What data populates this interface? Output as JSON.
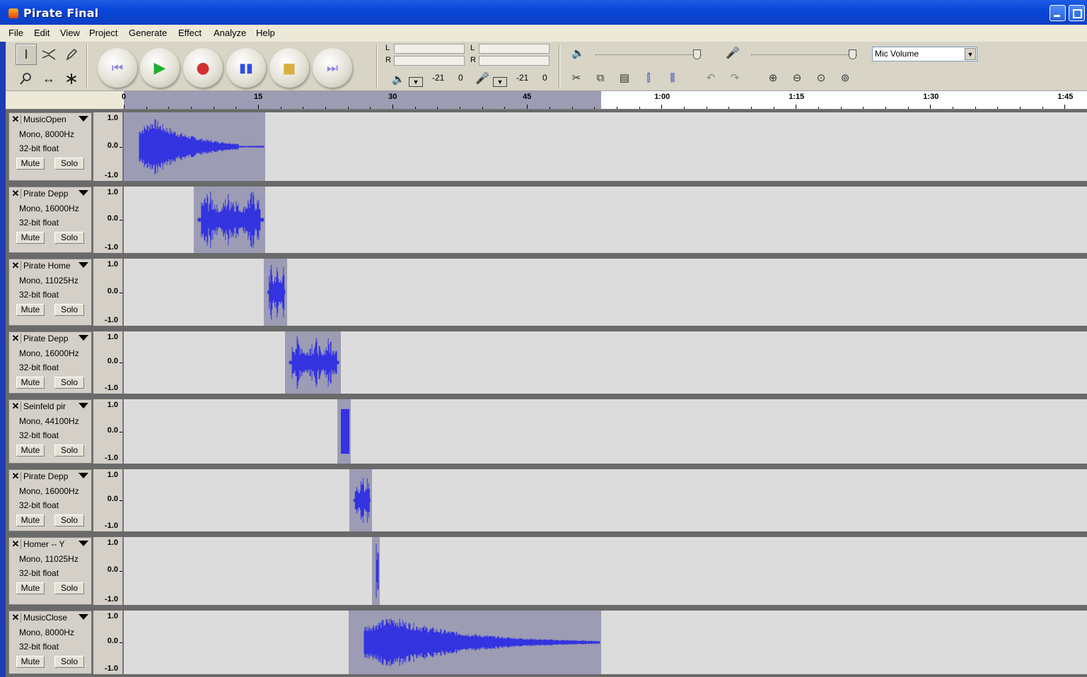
{
  "window": {
    "title": "Pirate Final"
  },
  "menu": [
    "File",
    "Edit",
    "View",
    "Project",
    "Generate",
    "Effect",
    "Analyze",
    "Help"
  ],
  "toolbar": {
    "tools": [
      "selection-tool",
      "envelope-tool",
      "draw-tool",
      "zoom-tool",
      "timeshift-tool",
      "multi-tool"
    ],
    "transport": [
      "skip-to-start",
      "play",
      "record",
      "pause",
      "stop",
      "skip-to-end"
    ],
    "meters": {
      "output_label_L": "L",
      "output_label_R": "R",
      "input_label_L": "L",
      "input_label_R": "R",
      "output_min": "-21",
      "output_max": "0",
      "input_min": "-21",
      "input_max": "0"
    },
    "mixer": {
      "output_level": 0.95,
      "input_level": 0.95,
      "input_source": "Mic Volume"
    }
  },
  "timeline": {
    "ticks": [
      "0",
      "15",
      "30",
      "45",
      "1:00",
      "1:15",
      "1:30",
      "1:45"
    ],
    "selection_start_sec": 0,
    "selection_end_sec": 53.3
  },
  "tracks": [
    {
      "name": "MusicOpen",
      "format": "Mono, 8000Hz",
      "sample": "32-bit float",
      "mute": "Mute",
      "solo": "Solo",
      "vmax": "1.0",
      "vmid": "0.0",
      "vmin": "-1.0",
      "clip_start_sec": 0.0,
      "clip_end_sec": 15.8,
      "wave": "music"
    },
    {
      "name": "Pirate Depp",
      "format": "Mono, 16000Hz",
      "sample": "32-bit float",
      "mute": "Mute",
      "solo": "Solo",
      "vmax": "1.0",
      "vmid": "0.0",
      "vmin": "-1.0",
      "clip_start_sec": 7.8,
      "clip_end_sec": 15.8,
      "wave": "speech"
    },
    {
      "name": "Pirate Home",
      "format": "Mono, 11025Hz",
      "sample": "32-bit float",
      "mute": "Mute",
      "solo": "Solo",
      "vmax": "1.0",
      "vmid": "0.0",
      "vmin": "-1.0",
      "clip_start_sec": 15.6,
      "clip_end_sec": 18.2,
      "wave": "speech"
    },
    {
      "name": "Pirate Depp",
      "format": "Mono, 16000Hz",
      "sample": "32-bit float",
      "mute": "Mute",
      "solo": "Solo",
      "vmax": "1.0",
      "vmid": "0.0",
      "vmin": "-1.0",
      "clip_start_sec": 18.0,
      "clip_end_sec": 24.2,
      "wave": "speech"
    },
    {
      "name": "Seinfeld pir",
      "format": "Mono, 44100Hz",
      "sample": "32-bit float",
      "mute": "Mute",
      "solo": "Solo",
      "vmax": "1.0",
      "vmid": "0.0",
      "vmin": "-1.0",
      "clip_start_sec": 23.8,
      "clip_end_sec": 25.3,
      "wave": "block"
    },
    {
      "name": "Pirate Depp",
      "format": "Mono, 16000Hz",
      "sample": "32-bit float",
      "mute": "Mute",
      "solo": "Solo",
      "vmax": "1.0",
      "vmid": "0.0",
      "vmin": "-1.0",
      "clip_start_sec": 25.2,
      "clip_end_sec": 27.7,
      "wave": "speech"
    },
    {
      "name": "Homer -- Y",
      "format": "Mono, 11025Hz",
      "sample": "32-bit float",
      "mute": "Mute",
      "solo": "Solo",
      "vmax": "1.0",
      "vmid": "0.0",
      "vmin": "-1.0",
      "clip_start_sec": 27.7,
      "clip_end_sec": 28.6,
      "wave": "spike"
    },
    {
      "name": "MusicClose",
      "format": "Mono, 8000Hz",
      "sample": "32-bit float",
      "mute": "Mute",
      "solo": "Solo",
      "vmax": "1.0",
      "vmid": "0.0",
      "vmin": "-1.0",
      "clip_start_sec": 25.1,
      "clip_end_sec": 53.3,
      "wave": "music"
    }
  ],
  "colors": {
    "waveform": "#3333e0",
    "selection": "#9c9cb4",
    "background": "#dcdcdc",
    "desktop": "#1e3cb4"
  }
}
